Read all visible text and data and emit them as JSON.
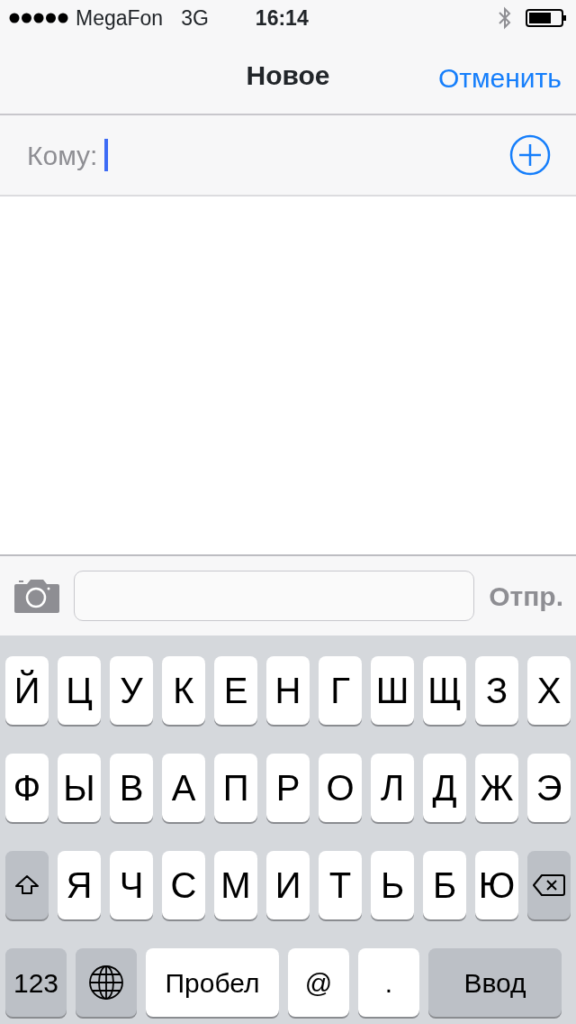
{
  "status_bar": {
    "carrier": "MegaFon",
    "network": "3G",
    "time": "16:14"
  },
  "nav": {
    "title": "Новое",
    "cancel": "Отменить"
  },
  "to_field": {
    "label": "Кому:",
    "focused": true
  },
  "compose": {
    "send": "Отпр.",
    "send_disabled": true
  },
  "keyboard": {
    "rows": [
      {
        "keys": [
          {
            "kind": "letter",
            "label": "Й"
          },
          {
            "kind": "letter",
            "label": "Ц"
          },
          {
            "kind": "letter",
            "label": "У"
          },
          {
            "kind": "letter",
            "label": "К"
          },
          {
            "kind": "letter",
            "label": "Е"
          },
          {
            "kind": "letter",
            "label": "Н"
          },
          {
            "kind": "letter",
            "label": "Г"
          },
          {
            "kind": "letter",
            "label": "Ш"
          },
          {
            "kind": "letter",
            "label": "Щ"
          },
          {
            "kind": "letter",
            "label": "З"
          },
          {
            "kind": "letter",
            "label": "Х"
          }
        ]
      },
      {
        "keys": [
          {
            "kind": "letter",
            "label": "Ф"
          },
          {
            "kind": "letter",
            "label": "Ы"
          },
          {
            "kind": "letter",
            "label": "В"
          },
          {
            "kind": "letter",
            "label": "А"
          },
          {
            "kind": "letter",
            "label": "П"
          },
          {
            "kind": "letter",
            "label": "Р"
          },
          {
            "kind": "letter",
            "label": "О"
          },
          {
            "kind": "letter",
            "label": "Л"
          },
          {
            "kind": "letter",
            "label": "Д"
          },
          {
            "kind": "letter",
            "label": "Ж"
          },
          {
            "kind": "letter",
            "label": "Э"
          }
        ]
      },
      {
        "keys": [
          {
            "kind": "shift"
          },
          {
            "kind": "letter",
            "label": "Я"
          },
          {
            "kind": "letter",
            "label": "Ч"
          },
          {
            "kind": "letter",
            "label": "С"
          },
          {
            "kind": "letter",
            "label": "М"
          },
          {
            "kind": "letter",
            "label": "И"
          },
          {
            "kind": "letter",
            "label": "Т"
          },
          {
            "kind": "letter",
            "label": "Ь"
          },
          {
            "kind": "letter",
            "label": "Б"
          },
          {
            "kind": "letter",
            "label": "Ю"
          },
          {
            "kind": "backspace"
          }
        ]
      },
      {
        "keys": [
          {
            "kind": "mode",
            "label": "123"
          },
          {
            "kind": "globe"
          },
          {
            "kind": "space",
            "label": "Пробел"
          },
          {
            "kind": "symbol",
            "label": "@"
          },
          {
            "kind": "symbol",
            "label": "."
          },
          {
            "kind": "return",
            "label": "Ввод"
          }
        ]
      }
    ]
  }
}
